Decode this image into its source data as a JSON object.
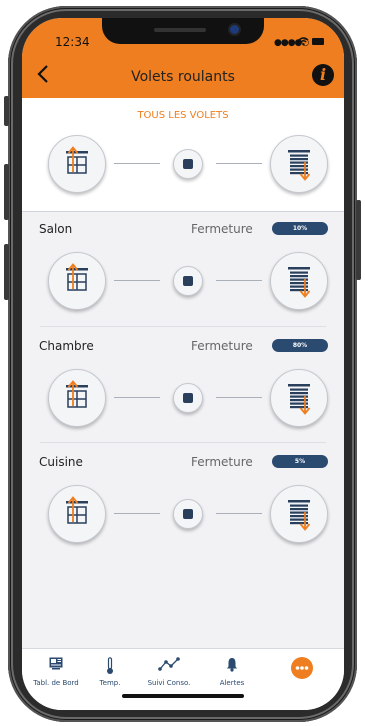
{
  "status": {
    "time": "12:34"
  },
  "header": {
    "title": "Volets roulants",
    "info_label": "i"
  },
  "all": {
    "label": "TOUS LES VOLETS"
  },
  "rooms": [
    {
      "name": "Salon",
      "action": "Fermeture",
      "percent": "10%"
    },
    {
      "name": "Chambre",
      "action": "Fermeture",
      "percent": "80%"
    },
    {
      "name": "Cuisine",
      "action": "Fermeture",
      "percent": "5%"
    }
  ],
  "tabs": [
    {
      "label": "Tabl. de Bord",
      "icon": "dashboard-icon"
    },
    {
      "label": "Temp.",
      "icon": "thermometer-icon"
    },
    {
      "label": "Suivi Conso.",
      "icon": "consumption-chart-icon"
    },
    {
      "label": "Alertes",
      "icon": "bell-icon"
    },
    {
      "label": "",
      "icon": "more-icon"
    }
  ],
  "colors": {
    "accent": "#ee7e1f",
    "navy": "#2a4a70",
    "background": "#f2f2f4"
  }
}
